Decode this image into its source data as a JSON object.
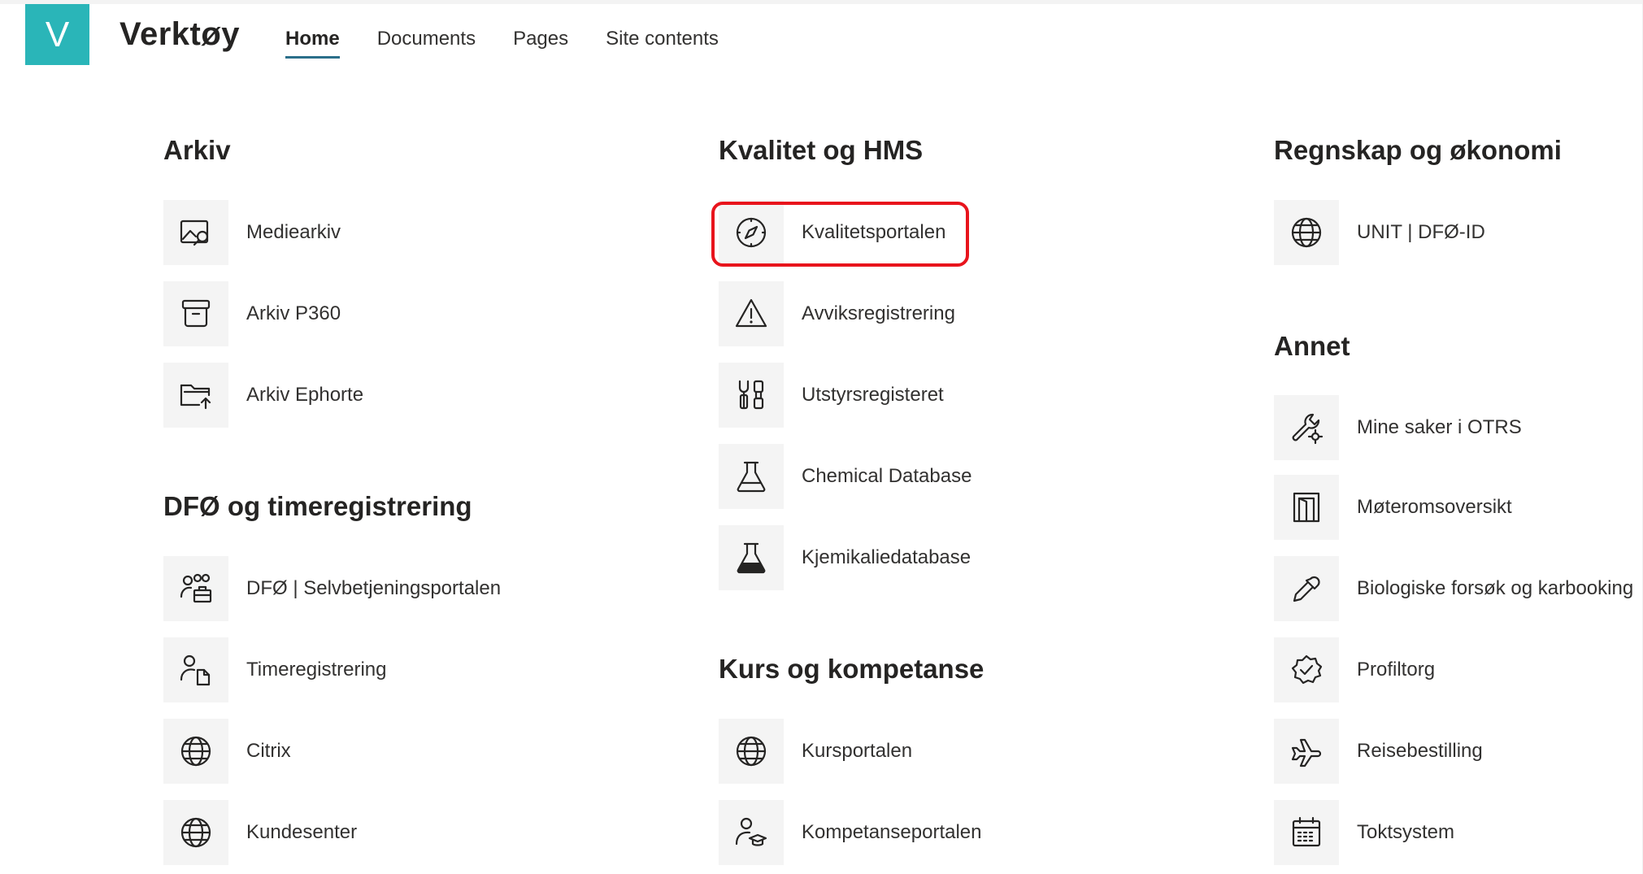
{
  "header": {
    "logo_letter": "V",
    "site_title": "Verktøy",
    "nav": [
      "Home",
      "Documents",
      "Pages",
      "Site contents"
    ],
    "active_nav": "Home"
  },
  "columns": [
    {
      "sections": [
        {
          "heading": "Arkiv",
          "links": [
            {
              "label": "Mediearkiv",
              "icon": "photo-search-icon"
            },
            {
              "label": "Arkiv P360",
              "icon": "archive-box-icon"
            },
            {
              "label": "Arkiv Ephorte",
              "icon": "folder-upload-icon"
            }
          ]
        },
        {
          "heading": "DFØ og timeregistrering",
          "links": [
            {
              "label": "DFØ | Selvbetjeningsportalen",
              "icon": "people-toolbox-icon"
            },
            {
              "label": "Timeregistrering",
              "icon": "person-document-icon"
            },
            {
              "label": "Citrix",
              "icon": "globe-icon"
            },
            {
              "label": "Kundesenter",
              "icon": "globe-icon"
            }
          ]
        }
      ]
    },
    {
      "sections": [
        {
          "heading": "Kvalitet og HMS",
          "links": [
            {
              "label": "Kvalitetsportalen",
              "icon": "compass-icon",
              "highlighted": true
            },
            {
              "label": "Avviksregistrering",
              "icon": "warning-icon"
            },
            {
              "label": "Utstyrsregisteret",
              "icon": "tools-icon"
            },
            {
              "label": "Chemical Database",
              "icon": "flask-outline-icon"
            },
            {
              "label": "Kjemikaliedatabase",
              "icon": "flask-filled-icon"
            }
          ]
        },
        {
          "heading": "Kurs og kompetanse",
          "links": [
            {
              "label": "Kursportalen",
              "icon": "globe-icon"
            },
            {
              "label": "Kompetanseportalen",
              "icon": "person-graduation-icon"
            }
          ]
        }
      ]
    },
    {
      "sections": [
        {
          "heading": "Regnskap og økonomi",
          "links": [
            {
              "label": "UNIT | DFØ-ID",
              "icon": "globe-icon"
            }
          ]
        },
        {
          "heading": "Annet",
          "links": [
            {
              "label": "Mine saker i OTRS",
              "icon": "wrench-settings-icon"
            },
            {
              "label": "Møteromsoversikt",
              "icon": "door-icon"
            },
            {
              "label": "Biologiske forsøk og karbooking",
              "icon": "eyedropper-icon"
            },
            {
              "label": "Profiltorg",
              "icon": "badge-check-icon"
            },
            {
              "label": "Reisebestilling",
              "icon": "airplane-icon"
            },
            {
              "label": "Toktsystem",
              "icon": "calendar-icon"
            }
          ]
        }
      ]
    }
  ],
  "colors": {
    "logo_bg": "#2ab5b8",
    "highlight": "#e8141c",
    "nav_underline": "#2b6f8a"
  }
}
